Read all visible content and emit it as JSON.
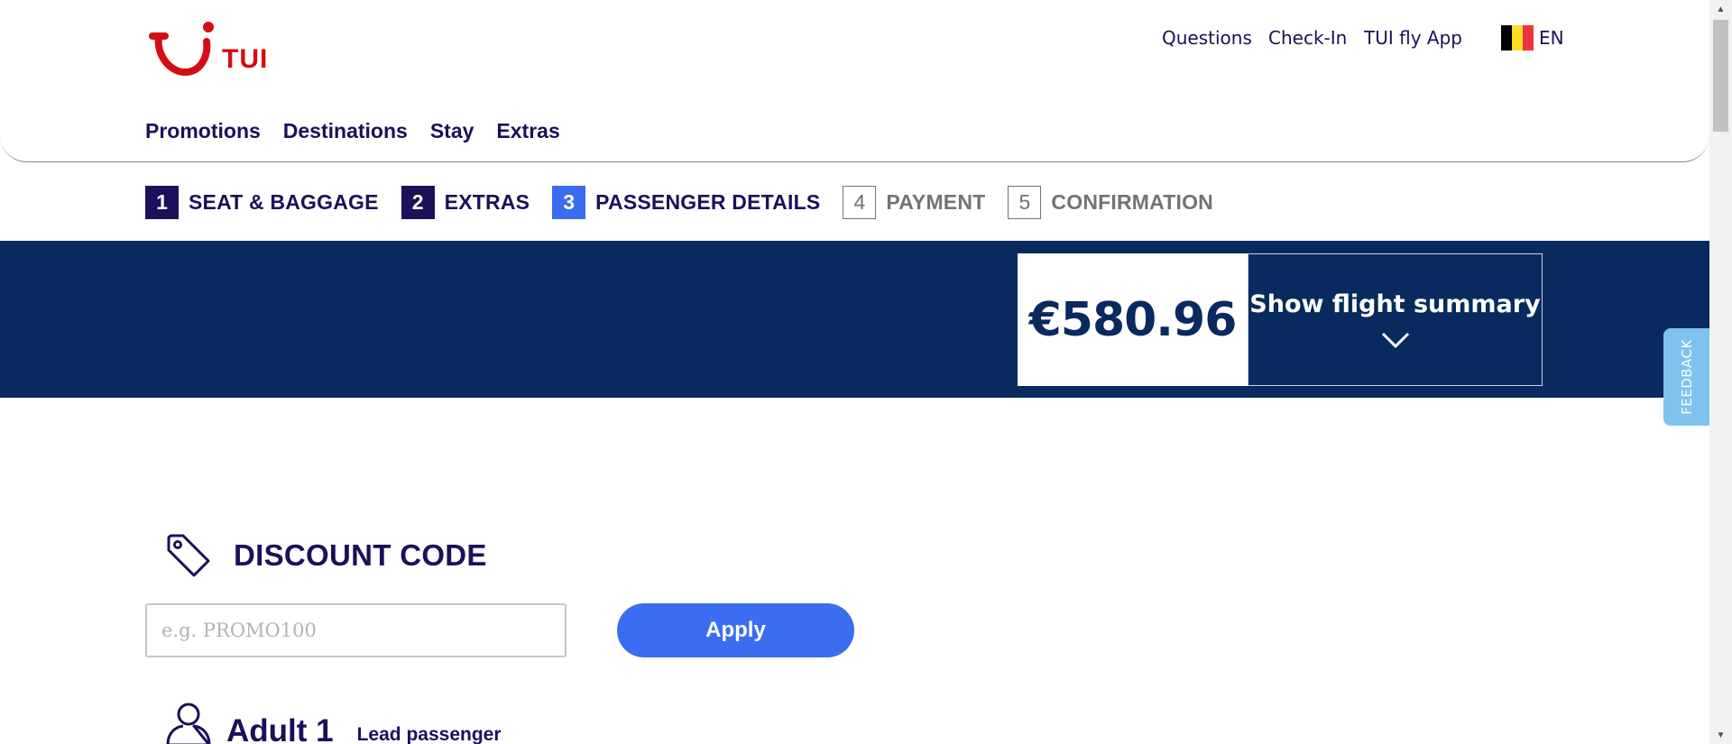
{
  "brand": {
    "name": "TUI",
    "color": "#d40e14"
  },
  "toplinks": [
    {
      "label": "Questions"
    },
    {
      "label": "Check-In"
    },
    {
      "label": "TUI fly App"
    }
  ],
  "language": {
    "label": "EN",
    "flag": "belgium-flag",
    "flag_colors": [
      "#000000",
      "#fdda24",
      "#ef3340"
    ]
  },
  "main_nav": [
    {
      "label": "Promotions"
    },
    {
      "label": "Destinations"
    },
    {
      "label": "Stay"
    },
    {
      "label": "Extras"
    }
  ],
  "steps": [
    {
      "number": "1",
      "label": "SEAT & BAGGAGE",
      "state": "done"
    },
    {
      "number": "2",
      "label": "EXTRAS",
      "state": "done"
    },
    {
      "number": "3",
      "label": "PASSENGER DETAILS",
      "state": "current"
    },
    {
      "number": "4",
      "label": "PAYMENT",
      "state": "future"
    },
    {
      "number": "5",
      "label": "CONFIRMATION",
      "state": "future"
    }
  ],
  "price_banner": {
    "price": "€580.96",
    "summary_label": "Show flight summary",
    "background": "#092a5e"
  },
  "feedback": {
    "label": "FEEDBACK"
  },
  "discount": {
    "title": "DISCOUNT CODE",
    "input_value": "",
    "placeholder": "e.g. PROMO100",
    "apply_label": "Apply",
    "icon": "tag-icon"
  },
  "passenger": {
    "title": "Adult 1",
    "lead_label": "Lead passenger",
    "icon": "person-icon"
  },
  "colors": {
    "navy_text": "#1a115a",
    "accent_blue": "#3a6df0",
    "banner_navy": "#092a5e",
    "feedback_blue": "#7ec3ee"
  }
}
